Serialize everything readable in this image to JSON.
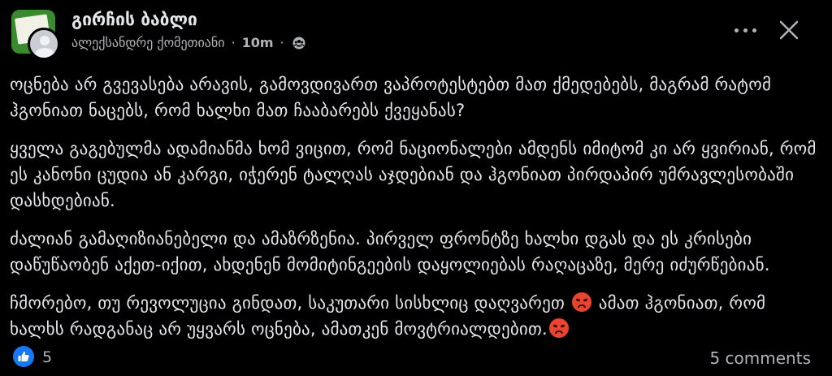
{
  "post": {
    "group_name": "გირჩის ბაბლი",
    "author": "ალექსანდრე ქომეთიანი",
    "separator": "·",
    "time": "10m",
    "audience_icon": "group-audience-icon",
    "paragraphs": [
      "ოცნება არ გვევასება არავის, გამოვდივართ ვაპროტესტებთ მათ ქმედებებს, მაგრამ რატომ ჰგონიათ ნაცებს, რომ ხალხი მათ ჩააბარებს ქვეყანას?",
      "ყველა გაგებულმა ადამიანმა ხომ ვიცით, რომ ნაციონალები ამდენს იმიტომ კი არ ყვირიან, რომ ეს კანონი ცუდია ან კარგი, იჭერენ ტალღას აჯდებიან და ჰგონიათ პირდაპირ უმრავლესობაში დასხდებიან.",
      "ძალიან გამაღიზიანებელი და ამაზრზენია. პირველ ფრონტზე ხალხი დგას და ეს კრისები დაწუწაობენ აქეთ-იქით, ახდენენ მომიტინგეების დაყოლიებას რაღაცაზე, მერე იძურწებიან."
    ],
    "para4_part1": "ჩმორებო, თუ რევოლუცია გინდათ, საკუთარი სისხლიც დაღვარეთ",
    "para4_part2": "ამათ ჰგონიათ, რომ ხალხს რადგანაც არ უყვარს ოცნება, ამათკენ მოვტრიალდებით.",
    "emoji_name": "angry-face-emoji"
  },
  "footer": {
    "like_count": "5",
    "comments": "5 comments"
  },
  "colors": {
    "background": "#000000",
    "text": "#e4e6eb",
    "secondary": "#b0b3b8",
    "like_blue": "#1877f2"
  }
}
